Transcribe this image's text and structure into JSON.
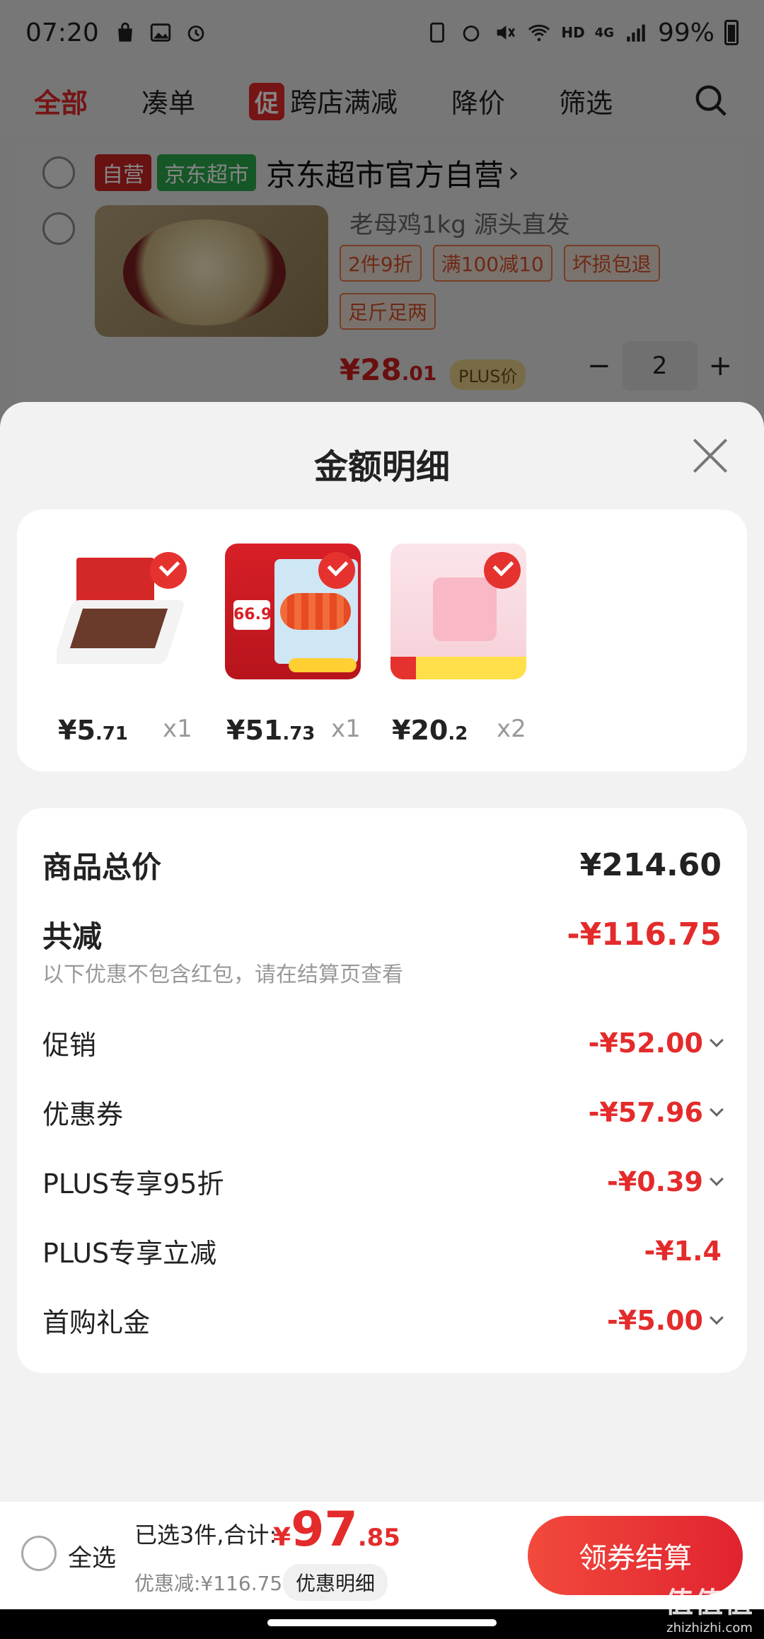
{
  "status_bar": {
    "time": "07:20",
    "network": "4G",
    "hd": "HD",
    "battery": "99%"
  },
  "filter_bar": {
    "tabs": [
      {
        "label": "全部"
      },
      {
        "label": "凑单"
      },
      {
        "label": "跨店满减",
        "badge": "促"
      },
      {
        "label": "降价"
      },
      {
        "label": "筛选"
      }
    ]
  },
  "shop": {
    "tag_self": "自营",
    "tag_supermarket": "京东超市",
    "name": "京东超市官方自营",
    "arrow": "›"
  },
  "product": {
    "title": "老母鸡1kg 源头直发",
    "tags": [
      "2件9折",
      "满100减10",
      "坏损包退",
      "足斤足两"
    ],
    "price_symbol": "¥",
    "price_int": "28",
    "price_dec": ".01",
    "plus_label": "PLUS价",
    "qty": "2",
    "minus": "−",
    "plus": "+"
  },
  "sheet": {
    "title": "金额明细",
    "items": [
      {
        "price_symbol": "¥",
        "price_int": "5",
        "price_dec": ".71",
        "qty": "x1"
      },
      {
        "price_symbol": "¥",
        "price_int": "51",
        "price_dec": ".73",
        "qty": "x1",
        "img_tag": "66.9"
      },
      {
        "price_symbol": "¥",
        "price_int": "20",
        "price_dec": ".2",
        "qty": "x2"
      }
    ],
    "summary": {
      "total_label": "商品总价",
      "total_value": "¥214.60",
      "reduce_label": "共减",
      "reduce_value": "-¥116.75",
      "note": "以下优惠不包含红包，请在结算页查看",
      "rows": [
        {
          "label": "促销",
          "value": "-¥52.00",
          "expandable": true
        },
        {
          "label": "优惠券",
          "value": "-¥57.96",
          "expandable": true
        },
        {
          "label": "PLUS专享95折",
          "value": "-¥0.39",
          "expandable": true
        },
        {
          "label": "PLUS专享立减",
          "value": "-¥1.4",
          "expandable": false
        },
        {
          "label": "首购礼金",
          "value": "-¥5.00",
          "expandable": true
        }
      ]
    }
  },
  "bottom_bar": {
    "select_all": "全选",
    "selected_text": "已选3件,合计:",
    "total_symbol": "¥",
    "total_int": "97",
    "total_dec": ".85",
    "discount_text": "优惠减:¥116.75",
    "detail_button": "优惠明细",
    "checkout_button": "领券结算"
  },
  "watermark": {
    "text": "值值值",
    "site": "zhizhizhi.com"
  },
  "colors": {
    "accent_red": "#e42b2b",
    "checkout_gradient_start": "#f24a3c",
    "checkout_gradient_end": "#e0232f",
    "supermarket_green": "#2aa84a"
  }
}
